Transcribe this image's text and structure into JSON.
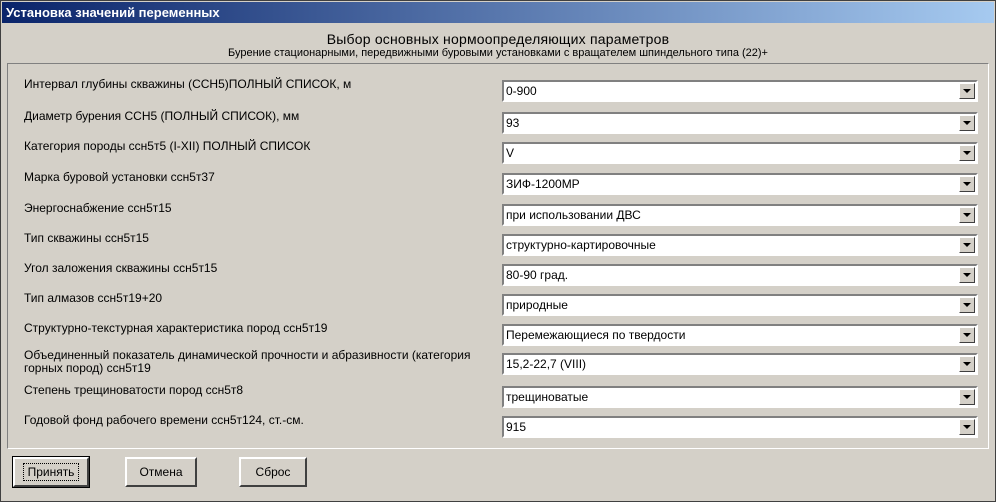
{
  "window": {
    "title": "Установка значений переменных"
  },
  "header": {
    "title": "Выбор основных нормоопределяющих параметров",
    "subtitle": "Бурение стационарными, передвижными буровыми установками с вращателем шпиндельного типа (22)+"
  },
  "fields": [
    {
      "label": "Интервал глубины скважины (ССН5)ПОЛНЫЙ СПИСОК, м",
      "value": "0-900"
    },
    {
      "label": "Диаметр бурения ССН5 (ПОЛНЫЙ СПИСОК), мм",
      "value": "93"
    },
    {
      "label": "Категория породы ссн5т5 (I-XII) ПОЛНЫЙ СПИСОК",
      "value": "V"
    },
    {
      "label": "Марка буровой установки ссн5т37",
      "value": "ЗИФ-1200МР"
    },
    {
      "label": "Энергоснабжение ссн5т15",
      "value": "при использовании ДВС"
    },
    {
      "label": "Тип скважины ссн5т15",
      "value": "структурно-картировочные"
    },
    {
      "label": "Угол заложения скважины ссн5т15",
      "value": "80-90 град."
    },
    {
      "label": "Тип алмазов ссн5т19+20",
      "value": "природные"
    },
    {
      "label": "Структурно-текстурная характеристика пород ссн5т19",
      "value": "Перемежающиеся по твердости"
    },
    {
      "label": "Объединенный показатель динамической прочности и абразивности (категория горных пород) ссн5т19",
      "value": "15,2-22,7 (VIII)"
    },
    {
      "label": "Степень трещиноватости пород ссн5т8",
      "value": "трещиноватые"
    },
    {
      "label": "Годовой фонд рабочего времени ссн5т124, ст.-см.",
      "value": "915"
    }
  ],
  "buttons": {
    "accept": "Принять",
    "cancel": "Отмена",
    "reset": "Сброс"
  }
}
